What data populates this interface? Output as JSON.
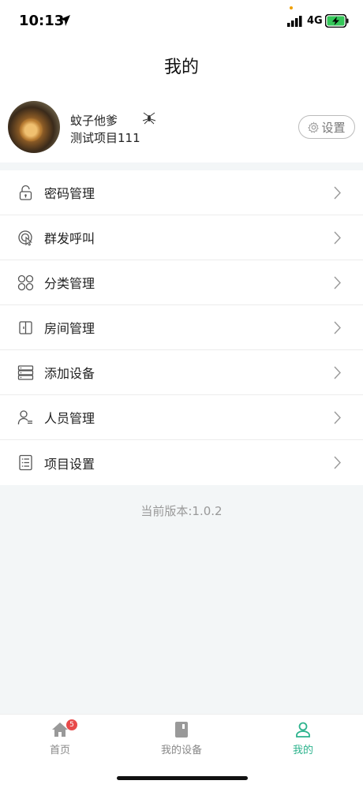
{
  "status": {
    "time": "10:13",
    "network": "4G"
  },
  "header": {
    "title": "我的"
  },
  "profile": {
    "name": "蚊子他爹",
    "project": "测试项目111",
    "settings_label": "设置"
  },
  "menu": [
    {
      "label": "密码管理",
      "icon": "lock-icon"
    },
    {
      "label": "群发呼叫",
      "icon": "broadcast-call-icon"
    },
    {
      "label": "分类管理",
      "icon": "category-icon"
    },
    {
      "label": "房间管理",
      "icon": "room-icon"
    },
    {
      "label": "添加设备",
      "icon": "server-icon"
    },
    {
      "label": "人员管理",
      "icon": "user-list-icon"
    },
    {
      "label": "项目设置",
      "icon": "project-list-icon"
    }
  ],
  "version_text": "当前版本:1.0.2",
  "tabs": {
    "home": {
      "label": "首页",
      "badge": "5"
    },
    "devices": {
      "label": "我的设备"
    },
    "mine": {
      "label": "我的"
    }
  },
  "colors": {
    "accent": "#2db38d",
    "badge": "#e84a4a",
    "background": "#f3f6f7"
  }
}
